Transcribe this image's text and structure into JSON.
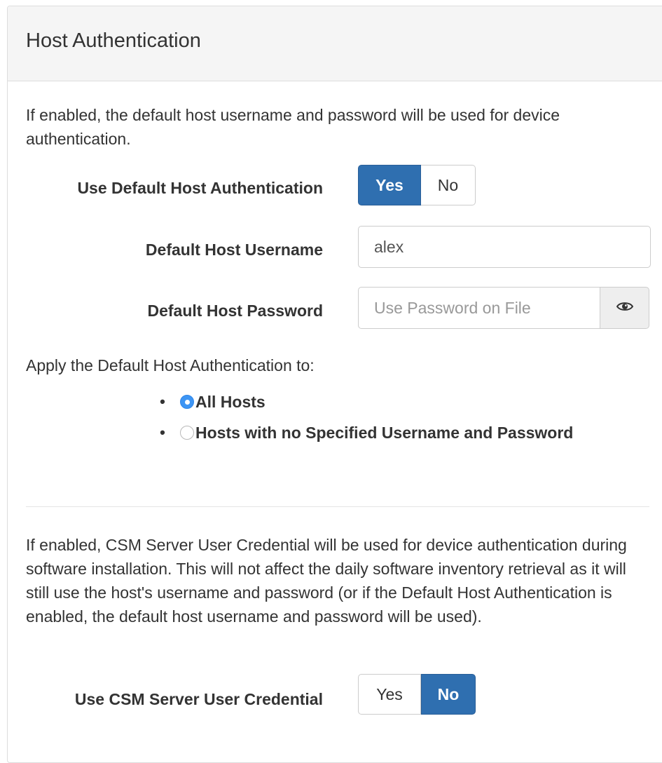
{
  "panel": {
    "title": "Host Authentication"
  },
  "host_auth": {
    "description": "If enabled, the default host username and password will be used for device authentication.",
    "use_default_label": "Use Default Host Authentication",
    "use_default_toggle": {
      "yes_label": "Yes",
      "no_label": "No",
      "selected": "Yes"
    },
    "username_label": "Default Host Username",
    "username_value": "alex",
    "password_label": "Default Host Password",
    "password_placeholder": "Use Password on File",
    "password_toggle_icon": "eye-icon",
    "apply_to_label": "Apply the Default Host Authentication to:",
    "apply_to_options": [
      {
        "label": "All Hosts",
        "checked": true
      },
      {
        "label": "Hosts with no Specified Username and Password",
        "checked": false
      }
    ]
  },
  "csm_credential": {
    "description": "If enabled, CSM Server User Credential will be used for device authentication during software installation. This will not affect the daily software inventory retrieval as it will still use the host's username and password (or if the Default Host Authentication is enabled, the default host username and password will be used).",
    "label": "Use CSM Server User Credential",
    "toggle": {
      "yes_label": "Yes",
      "no_label": "No",
      "selected": "No"
    }
  },
  "colors": {
    "active_button": "#2f6fb0",
    "radio_checked": "#3d95f4",
    "heading_bg": "#f5f5f5"
  }
}
